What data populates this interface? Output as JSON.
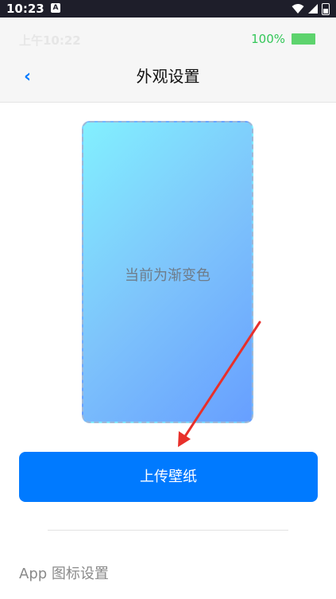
{
  "system_status": {
    "time": "10:23",
    "notif_glyph": "A"
  },
  "app_status": {
    "time": "上午10:22",
    "battery_percent": "100%",
    "battery_level": 1.0
  },
  "navbar": {
    "back_glyph": "‹",
    "title": "外观设置"
  },
  "preview": {
    "label": "当前为渐变色",
    "gradient_colors": [
      "#82f0ff",
      "#7ec4fb",
      "#679fff"
    ]
  },
  "upload_button": {
    "label": "上传壁纸",
    "color": "#007aff"
  },
  "section": {
    "label": "App 图标设置"
  },
  "annotation": {
    "arrow_color": "#e8302b"
  }
}
